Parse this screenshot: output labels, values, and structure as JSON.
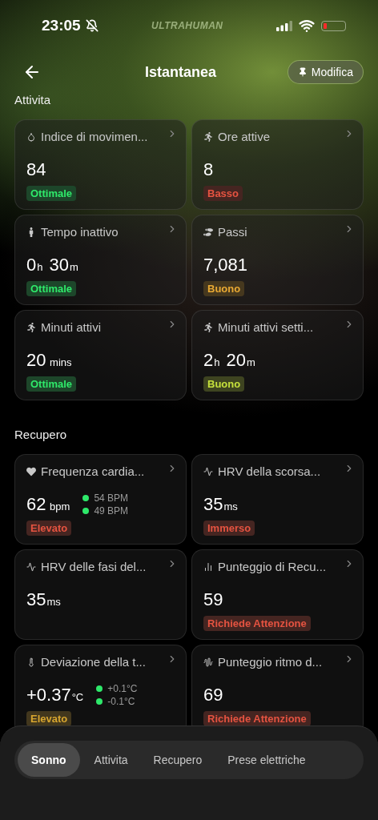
{
  "status_bar": {
    "time": "23:05",
    "brand": "ULTRAHUMAN"
  },
  "header": {
    "title": "Istantanea",
    "edit_button": "Modifica"
  },
  "sections": [
    {
      "title": "Attivita",
      "cards": [
        {
          "title": "Indice di movimen...",
          "value": [
            {
              "text": "84",
              "kind": "num"
            }
          ],
          "badge": {
            "label": "Ottimale",
            "color": "#1d462a"
          }
        },
        {
          "title": "Ore attive",
          "value": [
            {
              "text": "8",
              "kind": "num"
            }
          ],
          "badge": {
            "label": "Basso",
            "color": "#452521"
          }
        },
        {
          "title": "Tempo inattivo",
          "value": [
            {
              "text": "0",
              "kind": "num"
            },
            {
              "text": "h",
              "kind": "unit"
            },
            {
              "text": "30",
              "kind": "num"
            },
            {
              "text": "m",
              "kind": "unit"
            }
          ],
          "badge": {
            "label": "Ottimale",
            "color": "#1d462a"
          }
        },
        {
          "title": "Passi",
          "value": [
            {
              "text": "7,081",
              "kind": "num"
            }
          ],
          "badge": {
            "label": "Buono",
            "color": "#46381e"
          }
        },
        {
          "title": "Minuti attivi",
          "value": [
            {
              "text": "20",
              "kind": "num"
            },
            {
              "text": "mins",
              "kind": "unit"
            }
          ],
          "badge": {
            "label": "Ottimale",
            "color": "#1d462a"
          }
        },
        {
          "title": "Minuti attivi setti...",
          "value": [
            {
              "text": "2",
              "kind": "num"
            },
            {
              "text": "h",
              "kind": "unit"
            },
            {
              "text": "20",
              "kind": "num"
            },
            {
              "text": "m",
              "kind": "unit"
            }
          ],
          "badge": {
            "label": "Buono",
            "color": "#3e4420"
          }
        }
      ]
    },
    {
      "title": "Recupero",
      "cards": [
        {
          "title": "Frequenza cardia...",
          "value": [
            {
              "text": "62",
              "kind": "num"
            },
            {
              "text": "bpm",
              "kind": "unit"
            }
          ],
          "range": [
            "54 BPM",
            "49 BPM"
          ],
          "badge": {
            "label": "Elevato",
            "color": "#452521"
          }
        },
        {
          "title": "HRV della scorsa...",
          "value": [
            {
              "text": "35",
              "kind": "num"
            },
            {
              "text": "ms",
              "kind": "unit"
            }
          ],
          "badge": {
            "label": "Immerso",
            "color": "#452521"
          }
        },
        {
          "title": "HRV delle fasi del...",
          "value": [
            {
              "text": "35",
              "kind": "num"
            },
            {
              "text": "ms",
              "kind": "unit"
            }
          ]
        },
        {
          "title": "Punteggio di Recu...",
          "value": [
            {
              "text": "59",
              "kind": "num"
            }
          ],
          "badge": {
            "label": "Richiede Attenzione",
            "color": "#452521"
          }
        },
        {
          "title": "Deviazione della t...",
          "value": [
            {
              "text": "+0.37",
              "kind": "num"
            },
            {
              "text": "°C",
              "kind": "unit"
            }
          ],
          "range": [
            "+0.1°C",
            "-0.1°C"
          ],
          "badge": {
            "label": "Elevato",
            "color": "#42371d"
          }
        },
        {
          "title": "Punteggio ritmo d...",
          "value": [
            {
              "text": "69",
              "kind": "num"
            }
          ],
          "badge": {
            "label": "Richiede Attenzione",
            "color": "#452521"
          }
        }
      ]
    }
  ],
  "tabs": [
    {
      "label": "Sonno",
      "selected": true
    },
    {
      "label": "Attivita",
      "selected": false
    },
    {
      "label": "Recupero",
      "selected": false
    },
    {
      "label": "Prese elettriche",
      "selected": false
    }
  ]
}
